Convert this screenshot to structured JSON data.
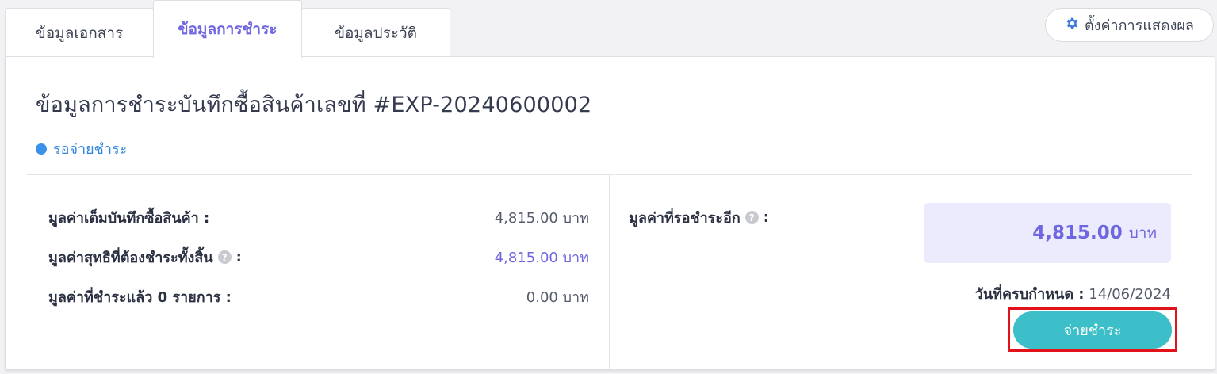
{
  "tabs": [
    {
      "label": "ข้อมูลเอกสาร",
      "active": false
    },
    {
      "label": "ข้อมูลการชำระ",
      "active": true
    },
    {
      "label": "ข้อมูลประวัติ",
      "active": false
    }
  ],
  "settings": {
    "label": "ตั้งค่าการแสดงผล",
    "icon": "gear-icon"
  },
  "page": {
    "title": "ข้อมูลการชำระบันทึกซื้อสินค้าเลขที่ #EXP-20240600002",
    "status": "รอจ่ายชำระ"
  },
  "summary": [
    {
      "label": "มูลค่าเต็มบันทึกซื้อสินค้า :",
      "value": "4,815.00 บาท"
    },
    {
      "label": "มูลค่าสุทธิที่ต้องชำระทั้งสิ้น",
      "colon": ":",
      "value": "4,815.00 บาท"
    },
    {
      "label": "มูลค่าที่ชำระแล้ว 0 รายการ :",
      "value": "0.00 บาท"
    }
  ],
  "outstanding": {
    "label": "มูลค่าที่รอชำระอีก",
    "colon": ":",
    "amount": "4,815.00",
    "unit": "บาท",
    "due_label": "วันที่ครบกำหนด :",
    "due_date": "14/06/2024",
    "pay_button": "จ่ายชำระ"
  },
  "help_glyph": "?",
  "colors": {
    "accent": "#6e67e0",
    "status": "#2f86e0",
    "pay": "#3cbfc8",
    "highlight": "#e2121b"
  }
}
